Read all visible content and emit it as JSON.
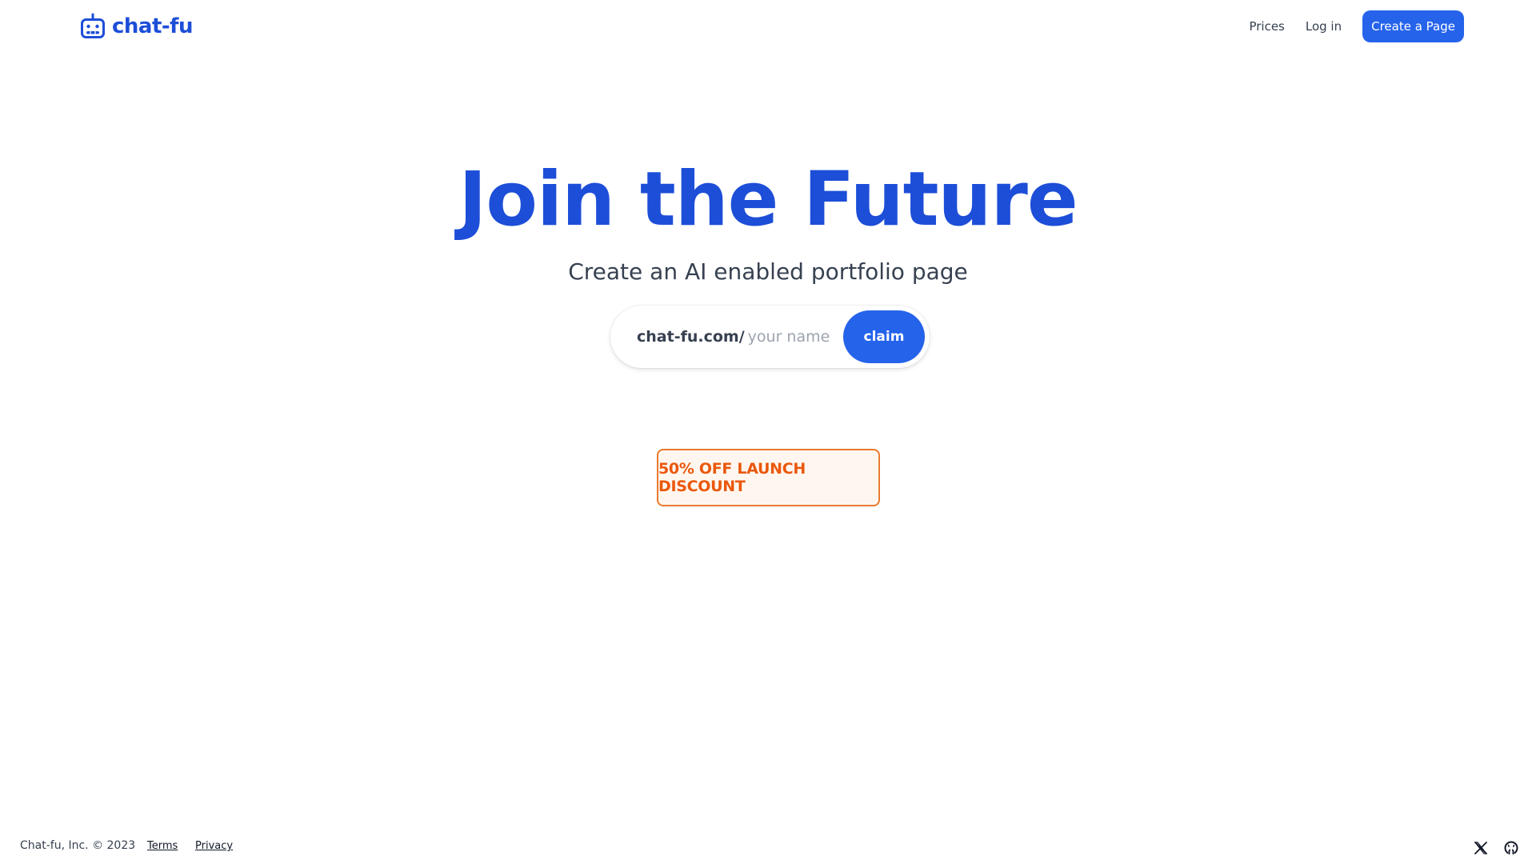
{
  "header": {
    "logo_text": "chat-fu",
    "logo_icon": "robot-icon",
    "nav": {
      "prices": "Prices",
      "login": "Log in",
      "cta": "Create a Page"
    }
  },
  "hero": {
    "title": "Join the Future",
    "subtitle": "Create an AI enabled portfolio page"
  },
  "claim": {
    "prefix": "chat-fu.com/",
    "input_value": "",
    "placeholder": "your name",
    "button": "claim"
  },
  "promo": {
    "label": "50% OFF LAUNCH DISCOUNT"
  },
  "footer": {
    "copyright": "Chat-fu, Inc. © 2023",
    "terms": "Terms",
    "privacy": "Privacy",
    "social": [
      "x-icon",
      "github-icon"
    ]
  },
  "colors": {
    "brand_blue": "#1d4ed8",
    "button_blue": "#2563eb",
    "promo_orange": "#ea580c",
    "promo_bg": "#fff7ef",
    "text_dark": "#374151"
  }
}
